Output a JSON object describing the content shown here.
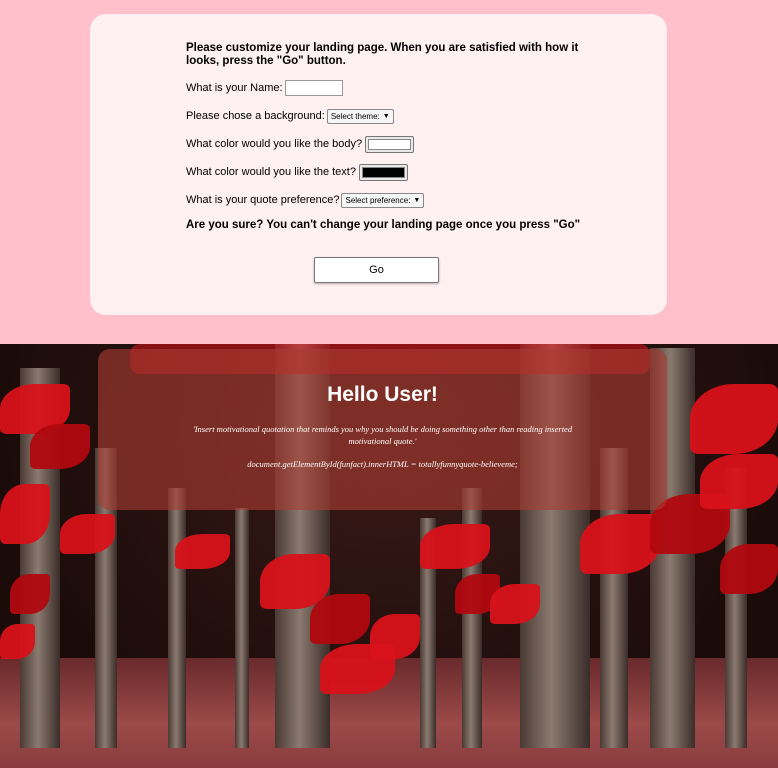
{
  "form": {
    "intro": "Please customize your landing page. When you are satisfied with how it looks, press the \"Go\" button.",
    "name_label": "What is your Name:",
    "name_value": "",
    "background_label": "Please chose a background:",
    "background_select": "Select theme:",
    "body_color_label": "What color would you like the body?",
    "body_color_value": "#ffffff",
    "text_color_label": "What color would you like the text?",
    "text_color_value": "#000000",
    "quote_label": "What is your quote preference?",
    "quote_select": "Select preference:",
    "warning": "Are you sure? You can't change your landing page once you press \"Go\"",
    "go_label": "Go"
  },
  "landing": {
    "greeting": "Hello User!",
    "quote": "'Insert motivational quotation that reminds you why you should be doing something other than reading inserted motivational quote.'",
    "code_line": "document.getElementById(funfact).innerHTML = totallyfunnyquote-believeme;"
  },
  "icons": {
    "select_arrow": "chevron-down-icon"
  },
  "colors": {
    "page_bg": "#ffc0cb",
    "card_bg": "#fff0f2",
    "overlay_bg": "rgba(170,60,50,0.62)",
    "leaf_red": "#d8121a"
  }
}
